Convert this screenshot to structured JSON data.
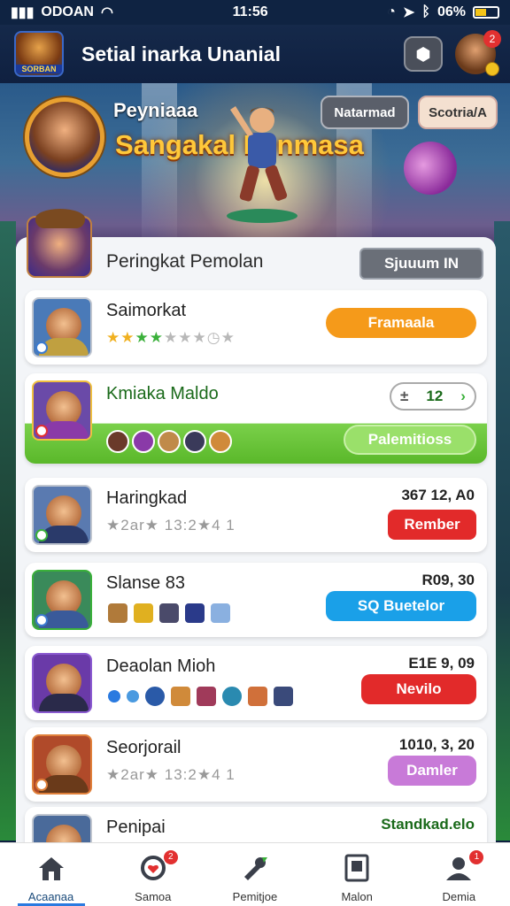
{
  "status_bar": {
    "carrier": "ODOAN",
    "time": "11:56",
    "battery": "06%"
  },
  "header": {
    "title": "Setial inarka Unanial",
    "logo_text": "SORBAN",
    "avatar_badge": "2"
  },
  "hero": {
    "label": "Peyniaaa",
    "title": "Sangakal Penmasa",
    "pill_1": "Natarmad",
    "pill_2": "Scotria/A"
  },
  "panel": {
    "title": "Peringkat Pemolan",
    "button": "Sjuuum IN"
  },
  "rows": [
    {
      "name": "Saimorkat",
      "button": "Framaala",
      "button_color": "#f59a1a",
      "stars": "★★★★★☆☆☆☆",
      "highlight": false
    },
    {
      "name": "Kmiaka Maldo",
      "stepper": "12",
      "button": "Palemitioss",
      "button_color": "#8ad85a",
      "highlight": true
    },
    {
      "name": "Haringkad",
      "score": "367 12, A0",
      "sub": "★2ar★ 13:2★4 1",
      "button": "Rember",
      "button_color": "#e22a2a"
    },
    {
      "name": "Slanse 83",
      "score": "R09, 30",
      "button": "SQ Buetelor",
      "button_color": "#1aa0e8"
    },
    {
      "name": "Deaolan Mioh",
      "score": "E1E 9, 09",
      "button": "Nevilo",
      "button_color": "#e22a2a"
    },
    {
      "name": "Seorjorail",
      "score": "1010, 3, 20",
      "sub": "★2ar★ 13:2★4 1",
      "button": "Damler",
      "button_color": "#c87ad8"
    },
    {
      "name": "Penipai",
      "score": "Standkad.elo"
    }
  ],
  "nav": [
    {
      "label": "Acaanaa",
      "icon": "home-icon",
      "active": true
    },
    {
      "label": "Samoa",
      "icon": "heart-icon",
      "badge": "2"
    },
    {
      "label": "Pemitjoe",
      "icon": "tools-icon"
    },
    {
      "label": "Malon",
      "icon": "card-icon"
    },
    {
      "label": "Demia",
      "icon": "profile-icon",
      "badge": "1"
    }
  ]
}
